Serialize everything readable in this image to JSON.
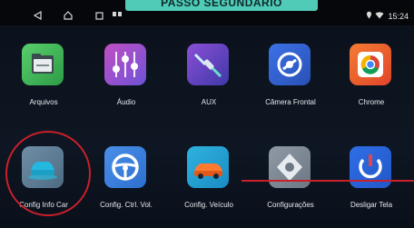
{
  "banner": "PASSO SEGUNDARIO",
  "status_bar": {
    "nav_icons": [
      "back-icon",
      "home-icon",
      "recents-icon"
    ],
    "time": "15:24",
    "signal_icons": [
      "location-icon",
      "wifi-icon"
    ]
  },
  "apps": [
    {
      "label": "Arquivos",
      "icon": "folder-icon"
    },
    {
      "label": "Áudio",
      "icon": "equalizer-icon"
    },
    {
      "label": "AUX",
      "icon": "aux-cable-icon"
    },
    {
      "label": "Câmera Frontal",
      "icon": "camera-icon"
    },
    {
      "label": "Chrome",
      "icon": "chrome-icon"
    },
    {
      "label": "Config Info Car",
      "icon": "car-icon"
    },
    {
      "label": "Config. Ctrl. Vol.",
      "icon": "steering-wheel-icon"
    },
    {
      "label": "Config. Veículo",
      "icon": "vehicle-icon"
    },
    {
      "label": "Configurações",
      "icon": "settings-icon"
    },
    {
      "label": "Desligar Tela",
      "icon": "power-icon"
    }
  ],
  "highlight_color": "#c9202a"
}
